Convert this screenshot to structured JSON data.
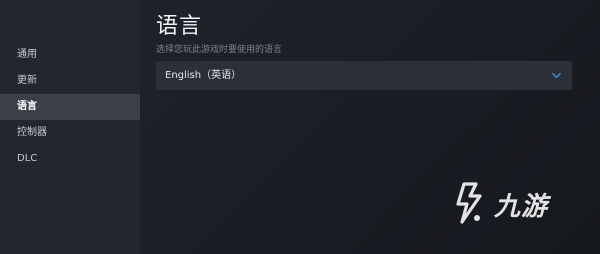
{
  "sidebar": {
    "items": [
      {
        "label": "通用"
      },
      {
        "label": "更新"
      },
      {
        "label": "语言"
      },
      {
        "label": "控制器"
      },
      {
        "label": "DLC"
      }
    ],
    "active_index": 2
  },
  "main": {
    "title": "语言",
    "subtitle": "选择您玩此游戏时要使用的语言",
    "language_select": {
      "value": "English（英语）",
      "icon": "chevron-down-icon"
    }
  },
  "watermark": {
    "text": "九游",
    "icon": "jiuyou-logo-icon"
  },
  "colors": {
    "sidebar_bg": "#23262d",
    "active_item_bg": "#3a3f48",
    "main_bg": "#1b1f26",
    "select_bg": "#2b2f37",
    "accent": "#3d8ee0"
  }
}
